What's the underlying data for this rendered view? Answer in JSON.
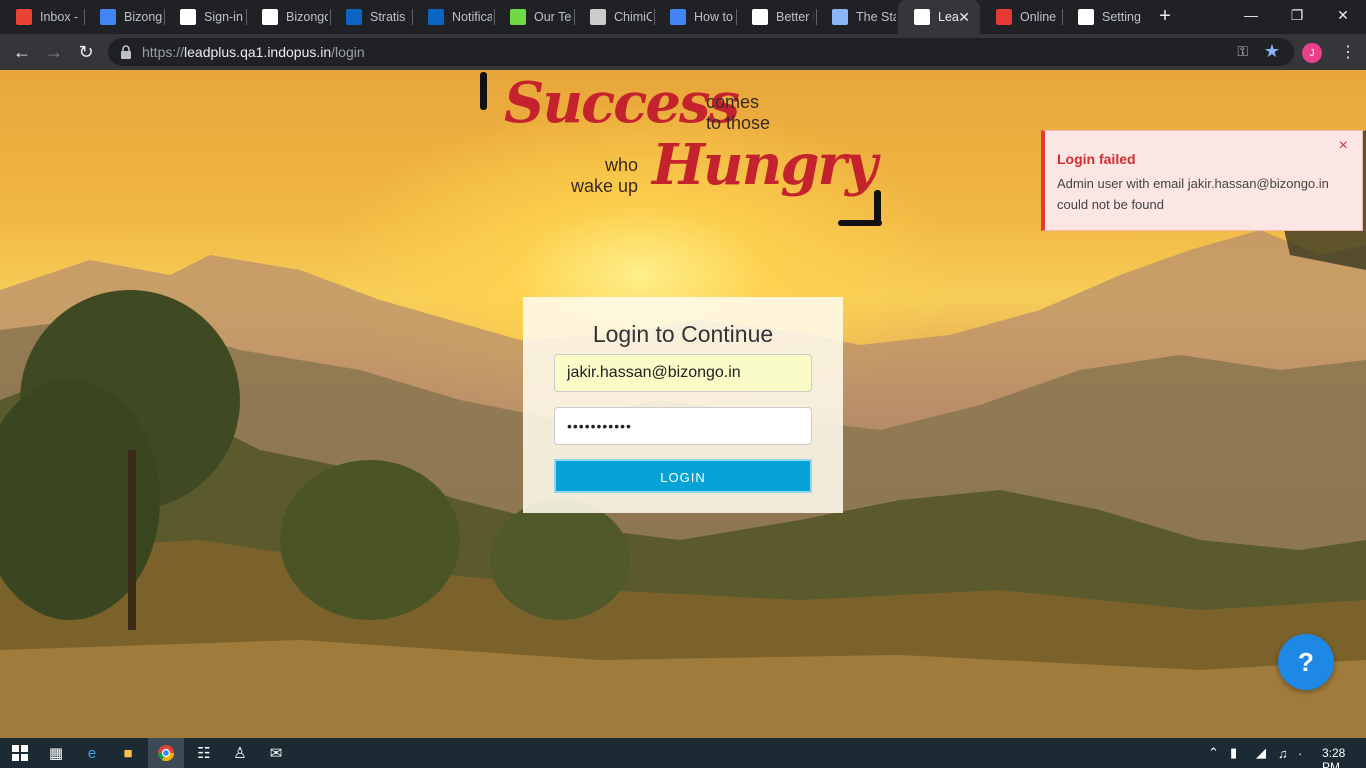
{
  "browser": {
    "tabs": [
      {
        "label": "Inbox -",
        "icon": "gmail-icon",
        "color": "#ea4335"
      },
      {
        "label": "Bizongo",
        "icon": "calendar-icon",
        "color": "#4285f4"
      },
      {
        "label": "Sign-in",
        "icon": "google-icon",
        "color": "#ffffff"
      },
      {
        "label": "Bizongo",
        "icon": "go-icon",
        "color": "#ffffff"
      },
      {
        "label": "Stratis I",
        "icon": "linkedin-icon",
        "color": "#0a66c2"
      },
      {
        "label": "Notifica",
        "icon": "linkedin-icon",
        "color": "#0a66c2"
      },
      {
        "label": "Our Tea",
        "icon": "upwork-icon",
        "color": "#6fda44"
      },
      {
        "label": "ChimiC",
        "icon": "grid-icon",
        "color": "#cccccc"
      },
      {
        "label": "How to",
        "icon": "chart-icon",
        "color": "#4285f4"
      },
      {
        "label": "Better E",
        "icon": "b-logo-icon",
        "color": "#ffffff"
      },
      {
        "label": "The Sta",
        "icon": "image-icon",
        "color": "#8ab4f8"
      },
      {
        "label": "Lea",
        "icon": "go-icon",
        "color": "#ffffff",
        "active": true
      },
      {
        "label": "Online",
        "icon": "u-logo-icon",
        "color": "#e53935"
      },
      {
        "label": "Setting",
        "icon": "gear-icon",
        "color": "#ffffff"
      }
    ],
    "url_prefix": "https://",
    "url_host": "leadplus.qa1.indopus.in",
    "url_path": "/login",
    "profile_initial": "J"
  },
  "slogan": {
    "word1": "Success",
    "line_comes_1": "comes",
    "line_comes_2": "to those",
    "line_who_1": "who",
    "line_who_2": "wake up",
    "word2": "Hungry"
  },
  "login": {
    "title": "Login to Continue",
    "email_value": "jakir.hassan@bizongo.in",
    "password_value": "•••••••••••",
    "button_label": "LOGIN"
  },
  "toast": {
    "title": "Login failed",
    "message": "Admin user with email jakir.hassan@bizongo.in could not be found",
    "close": "×"
  },
  "help": {
    "label": "?"
  },
  "taskbar": {
    "clock": "3:28 PM"
  },
  "colors": {
    "accent": "#05a3d6",
    "brand_red": "#c4232e",
    "error": "#d32f2f",
    "help_blue": "#1e88e5"
  }
}
